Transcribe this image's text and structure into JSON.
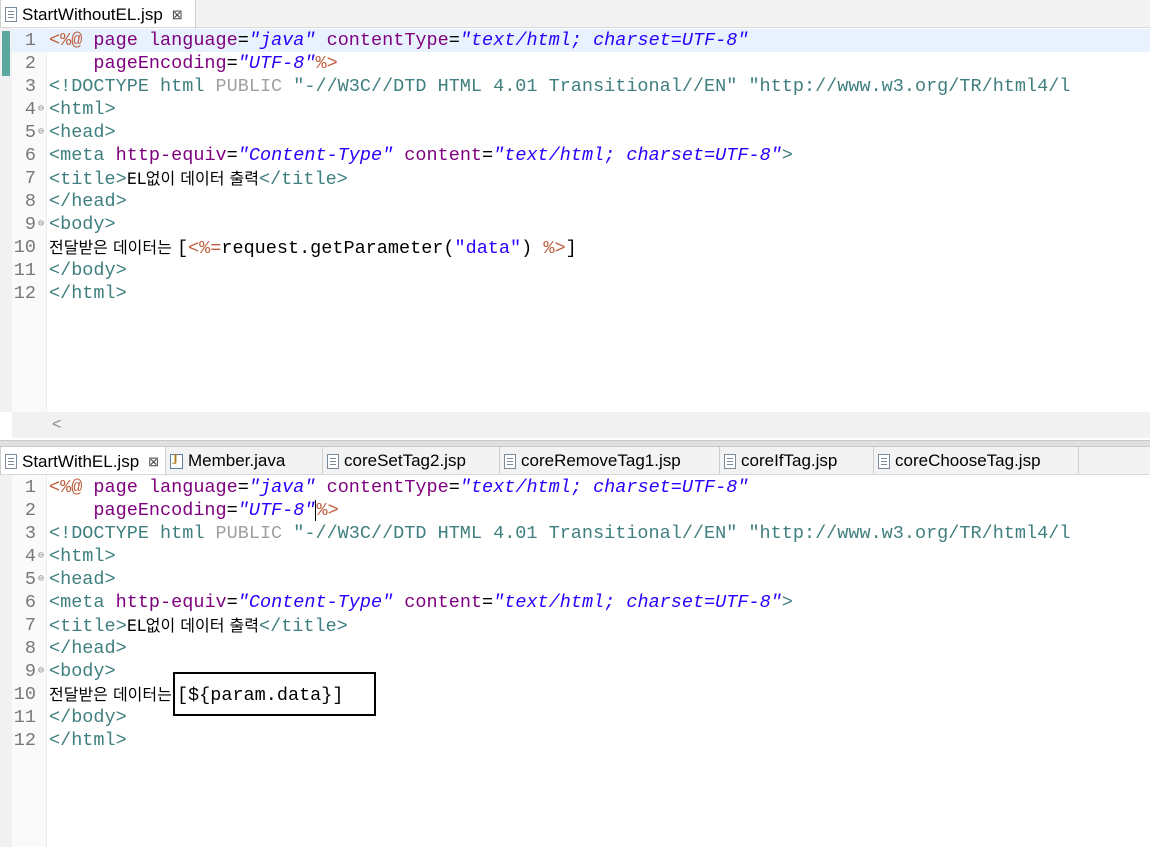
{
  "colors": {
    "tag": "#3f7f7f",
    "attr": "#7f007f",
    "value": "#2a00ff",
    "jsp": "#bf5f3f",
    "text": "#000000",
    "current_line": "#e8f2fe"
  },
  "top_editor": {
    "tab": {
      "label": "StartWithoutEL.jsp",
      "close": "⊠"
    },
    "lines": [
      {
        "num": "1",
        "fold": "",
        "current": true,
        "segments": [
          {
            "t": "<%@ ",
            "c": "jsp"
          },
          {
            "t": "page ",
            "c": "attr"
          },
          {
            "t": "language",
            "c": "attr"
          },
          {
            "t": "=",
            "c": "text"
          },
          {
            "t": "\"java\"",
            "c": "value",
            "i": true
          },
          {
            "t": " contentType",
            "c": "attr"
          },
          {
            "t": "=",
            "c": "text"
          },
          {
            "t": "\"text/html; charset=UTF-8\"",
            "c": "value",
            "i": true
          }
        ]
      },
      {
        "num": "2",
        "fold": "",
        "segments": [
          {
            "t": "    pageEncoding",
            "c": "attr"
          },
          {
            "t": "=",
            "c": "text"
          },
          {
            "t": "\"UTF-8\"",
            "c": "value",
            "i": true
          },
          {
            "t": "%>",
            "c": "jsp"
          }
        ]
      },
      {
        "num": "3",
        "fold": "",
        "segments": [
          {
            "t": "<!DOCTYPE ",
            "c": "tag"
          },
          {
            "t": "html ",
            "c": "tag"
          },
          {
            "t": "PUBLIC ",
            "c": "grey"
          },
          {
            "t": "\"-//W3C//DTD HTML 4.01 Transitional//EN\" ",
            "c": "tag"
          },
          {
            "t": "\"http://www.w3.org/TR/html4/l",
            "c": "tag"
          }
        ]
      },
      {
        "num": "4",
        "fold": "⊖",
        "segments": [
          {
            "t": "<html>",
            "c": "tag"
          }
        ]
      },
      {
        "num": "5",
        "fold": "⊖",
        "segments": [
          {
            "t": "<head>",
            "c": "tag"
          }
        ]
      },
      {
        "num": "6",
        "fold": "",
        "segments": [
          {
            "t": "<meta ",
            "c": "tag"
          },
          {
            "t": "http-equiv",
            "c": "attr"
          },
          {
            "t": "=",
            "c": "text"
          },
          {
            "t": "\"Content-Type\"",
            "c": "value",
            "i": true
          },
          {
            "t": " content",
            "c": "attr"
          },
          {
            "t": "=",
            "c": "text"
          },
          {
            "t": "\"text/html; charset=UTF-8\"",
            "c": "value",
            "i": true
          },
          {
            "t": ">",
            "c": "tag"
          }
        ]
      },
      {
        "num": "7",
        "fold": "",
        "segments": [
          {
            "t": "<title>",
            "c": "tag"
          },
          {
            "t": "EL없이 데이터 출력",
            "c": "text",
            "ko": true
          },
          {
            "t": "</title>",
            "c": "tag"
          }
        ]
      },
      {
        "num": "8",
        "fold": "",
        "segments": [
          {
            "t": "</head>",
            "c": "tag"
          }
        ]
      },
      {
        "num": "9",
        "fold": "⊖",
        "segments": [
          {
            "t": "<body>",
            "c": "tag"
          }
        ]
      },
      {
        "num": "10",
        "fold": "",
        "segments": [
          {
            "t": "전달받은 데이터는 ",
            "c": "text",
            "ko": true
          },
          {
            "t": "[",
            "c": "text"
          },
          {
            "t": "<%=",
            "c": "jsp"
          },
          {
            "t": "request.getParameter(",
            "c": "text"
          },
          {
            "t": "\"data\"",
            "c": "value"
          },
          {
            "t": ") ",
            "c": "text"
          },
          {
            "t": "%>",
            "c": "jsp"
          },
          {
            "t": "]",
            "c": "text"
          }
        ]
      },
      {
        "num": "11",
        "fold": "",
        "segments": [
          {
            "t": "</body>",
            "c": "tag"
          }
        ]
      },
      {
        "num": "12",
        "fold": "",
        "segments": [
          {
            "t": "</html>",
            "c": "tag"
          }
        ]
      }
    ],
    "hscroll_arrow": "<"
  },
  "bottom_editor": {
    "tabs": [
      {
        "label": "StartWithEL.jsp",
        "icon": "jsp-file-icon",
        "active": true,
        "close": "⊠"
      },
      {
        "label": "Member.java",
        "icon": "java-file-icon"
      },
      {
        "label": "coreSetTag2.jsp",
        "icon": "jsp-file-icon"
      },
      {
        "label": "coreRemoveTag1.jsp",
        "icon": "jsp-file-icon"
      },
      {
        "label": "coreIfTag.jsp",
        "icon": "jsp-file-icon"
      },
      {
        "label": "coreChooseTag.jsp",
        "icon": "jsp-file-icon"
      }
    ],
    "lines": [
      {
        "num": "1",
        "fold": "",
        "segments": [
          {
            "t": "<%@ ",
            "c": "jsp"
          },
          {
            "t": "page ",
            "c": "attr"
          },
          {
            "t": "language",
            "c": "attr"
          },
          {
            "t": "=",
            "c": "text"
          },
          {
            "t": "\"java\"",
            "c": "value",
            "i": true
          },
          {
            "t": " contentType",
            "c": "attr"
          },
          {
            "t": "=",
            "c": "text"
          },
          {
            "t": "\"text/html; charset=UTF-8\"",
            "c": "value",
            "i": true
          }
        ]
      },
      {
        "num": "2",
        "fold": "",
        "segments": [
          {
            "t": "    pageEncoding",
            "c": "attr"
          },
          {
            "t": "=",
            "c": "text"
          },
          {
            "t": "\"UTF-8\"",
            "c": "value",
            "i": true
          },
          {
            "t": "%>",
            "c": "jsp",
            "caret": true
          }
        ]
      },
      {
        "num": "3",
        "fold": "",
        "segments": [
          {
            "t": "<!DOCTYPE ",
            "c": "tag"
          },
          {
            "t": "html ",
            "c": "tag"
          },
          {
            "t": "PUBLIC ",
            "c": "grey"
          },
          {
            "t": "\"-//W3C//DTD HTML 4.01 Transitional//EN\" ",
            "c": "tag"
          },
          {
            "t": "\"http://www.w3.org/TR/html4/l",
            "c": "tag"
          }
        ]
      },
      {
        "num": "4",
        "fold": "⊖",
        "segments": [
          {
            "t": "<html>",
            "c": "tag"
          }
        ]
      },
      {
        "num": "5",
        "fold": "⊖",
        "segments": [
          {
            "t": "<head>",
            "c": "tag"
          }
        ]
      },
      {
        "num": "6",
        "fold": "",
        "segments": [
          {
            "t": "<meta ",
            "c": "tag"
          },
          {
            "t": "http-equiv",
            "c": "attr"
          },
          {
            "t": "=",
            "c": "text"
          },
          {
            "t": "\"Content-Type\"",
            "c": "value",
            "i": true
          },
          {
            "t": " content",
            "c": "attr"
          },
          {
            "t": "=",
            "c": "text"
          },
          {
            "t": "\"text/html; charset=UTF-8\"",
            "c": "value",
            "i": true
          },
          {
            "t": ">",
            "c": "tag"
          }
        ]
      },
      {
        "num": "7",
        "fold": "",
        "segments": [
          {
            "t": "<title>",
            "c": "tag"
          },
          {
            "t": "EL없이 데이터 출력",
            "c": "text",
            "ko": true
          },
          {
            "t": "</title>",
            "c": "tag"
          }
        ]
      },
      {
        "num": "8",
        "fold": "",
        "segments": [
          {
            "t": "</head>",
            "c": "tag"
          }
        ]
      },
      {
        "num": "9",
        "fold": "⊖",
        "segments": [
          {
            "t": "<body>",
            "c": "tag"
          }
        ]
      },
      {
        "num": "10",
        "fold": "",
        "segments": [
          {
            "t": "전달받은 데이터는 ",
            "c": "text",
            "ko": true
          },
          {
            "t": "[",
            "c": "text"
          },
          {
            "t": "${param.data}",
            "c": "text"
          },
          {
            "t": "]",
            "c": "text"
          }
        ]
      },
      {
        "num": "11",
        "fold": "",
        "segments": [
          {
            "t": "</body>",
            "c": "tag"
          }
        ]
      },
      {
        "num": "12",
        "fold": "",
        "segments": [
          {
            "t": "</html>",
            "c": "tag"
          }
        ]
      }
    ]
  }
}
